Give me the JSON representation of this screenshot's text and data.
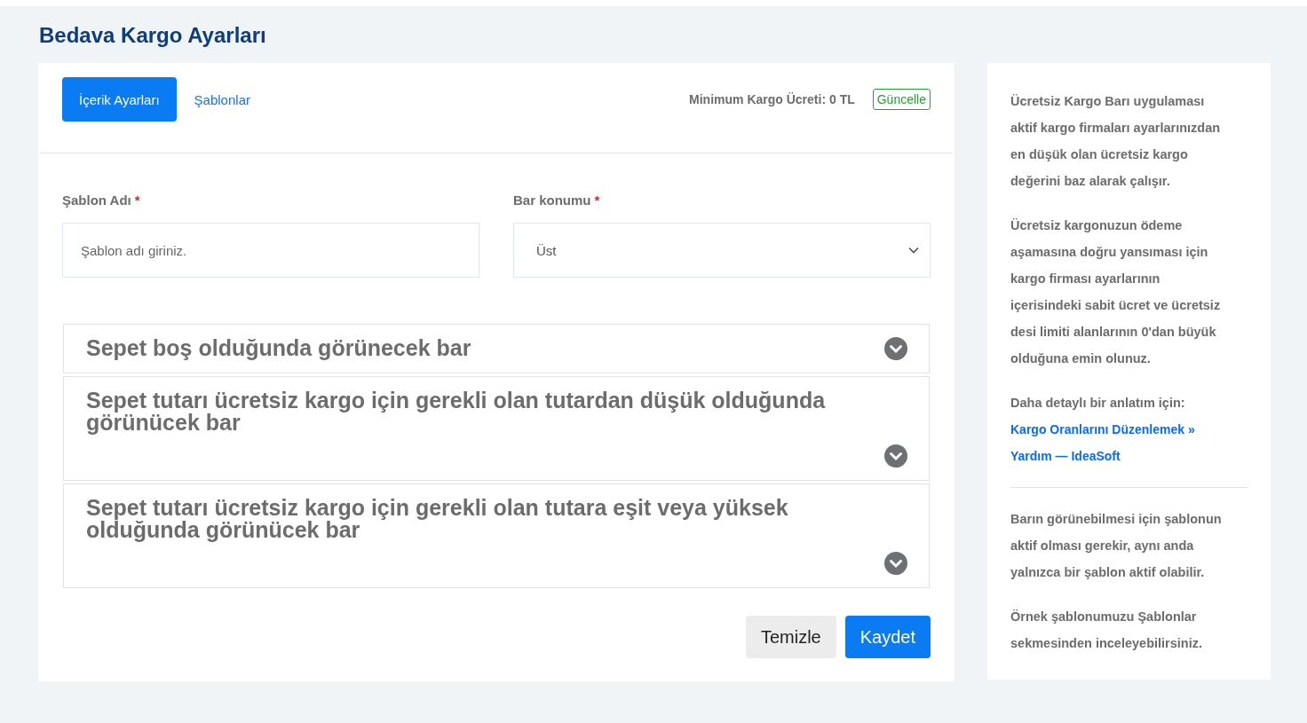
{
  "page": {
    "title": "Bedava Kargo Ayarları"
  },
  "tabs": [
    {
      "label": "İçerik Ayarları",
      "selected": true
    },
    {
      "label": "Şablonlar",
      "selected": false
    }
  ],
  "min_shipping": {
    "label": "Minimum Kargo Ücreti: 0 TL",
    "button": "Güncelle"
  },
  "fields": [
    {
      "kind": "text",
      "label": "Şablon Adı",
      "required_mark": "*",
      "placeholder": "Şablon adı giriniz."
    },
    {
      "kind": "select",
      "label": "Bar konumu",
      "required_mark": "*",
      "value": "Üst"
    }
  ],
  "sections": [
    {
      "title": "Sepet boş olduğunda görünecek bar",
      "expanded": false
    },
    {
      "title": "Sepet tutarı ücretsiz kargo için gerekli olan tutardan düşük olduğunda görünücek bar",
      "expanded": false
    },
    {
      "title": "Sepet tutarı ücretsiz kargo için gerekli olan tutara eşit veya yüksek olduğunda görünücek bar",
      "expanded": false
    }
  ],
  "buttons": [
    {
      "kind": "secondary",
      "label": "Temizle"
    },
    {
      "kind": "primary",
      "label": "Kaydet"
    }
  ],
  "info": {
    "paragraphs": [
      "Ücretsiz Kargo Barı uygulaması aktif kargo firmaları ayarlarınızdan en düşük olan ücretsiz kargo değerini baz alarak çalışır.",
      "Ücretsiz kargonuzun ödeme aşamasına doğru yansıması için kargo firması ayarlarının içerisindeki sabit ücret ve ücretsiz desi limiti alanlarının 0'dan büyük olduğuna emin olunuz.",
      "Daha detaylı bir anlatım için:"
    ],
    "links": [
      "Kargo Oranlarını Düzenlemek »",
      "Yardım — IdeaSoft"
    ],
    "notes": [
      "Barın görünebilmesi için şablonun aktif olması gerekir, aynı anda yalnızca bir şablon aktif olabilir.",
      "Örnek şablonumuzu Şablonlar sekmesinden inceleyebilirsiniz."
    ]
  }
}
